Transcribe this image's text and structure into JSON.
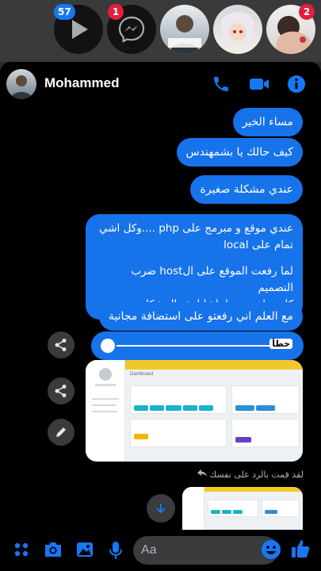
{
  "chat_heads": [
    {
      "name": "video-chathead",
      "badge": "57"
    },
    {
      "name": "messenger-chathead",
      "badge": "1"
    },
    {
      "name": "contact-chathead-1",
      "badge": ""
    },
    {
      "name": "contact-chathead-2",
      "badge": ""
    },
    {
      "name": "contact-chathead-3",
      "badge": "2"
    }
  ],
  "header": {
    "contact_name": "Mohammed"
  },
  "messages": [
    {
      "text": "مساء الخير"
    },
    {
      "text": "كيف حالك يا بشمهندس"
    },
    {
      "text": "عندي مشكلة صغيرة"
    },
    {
      "line1": "عندي موقع و مبرمج على php ....وكل اشي",
      "line2": "تمام على local",
      "line3": "لما رفعت الموقع على الhost ضرب التصميم",
      "line4": "كلو ...اخبرني يا باشا ايش المشكلة"
    },
    {
      "text": "مع العلم اني رفعتو على استضافة مجانية"
    }
  ],
  "audio": {
    "label": "خطأ"
  },
  "attachment": {
    "title": "Dashboard"
  },
  "reply_note": "لقد قمت بالرد على نفسك",
  "composer": {
    "placeholder": "Aa"
  },
  "colors": {
    "bubble": "#1673ea",
    "accent": "#1877f2",
    "badge_red": "#e41e3f"
  }
}
